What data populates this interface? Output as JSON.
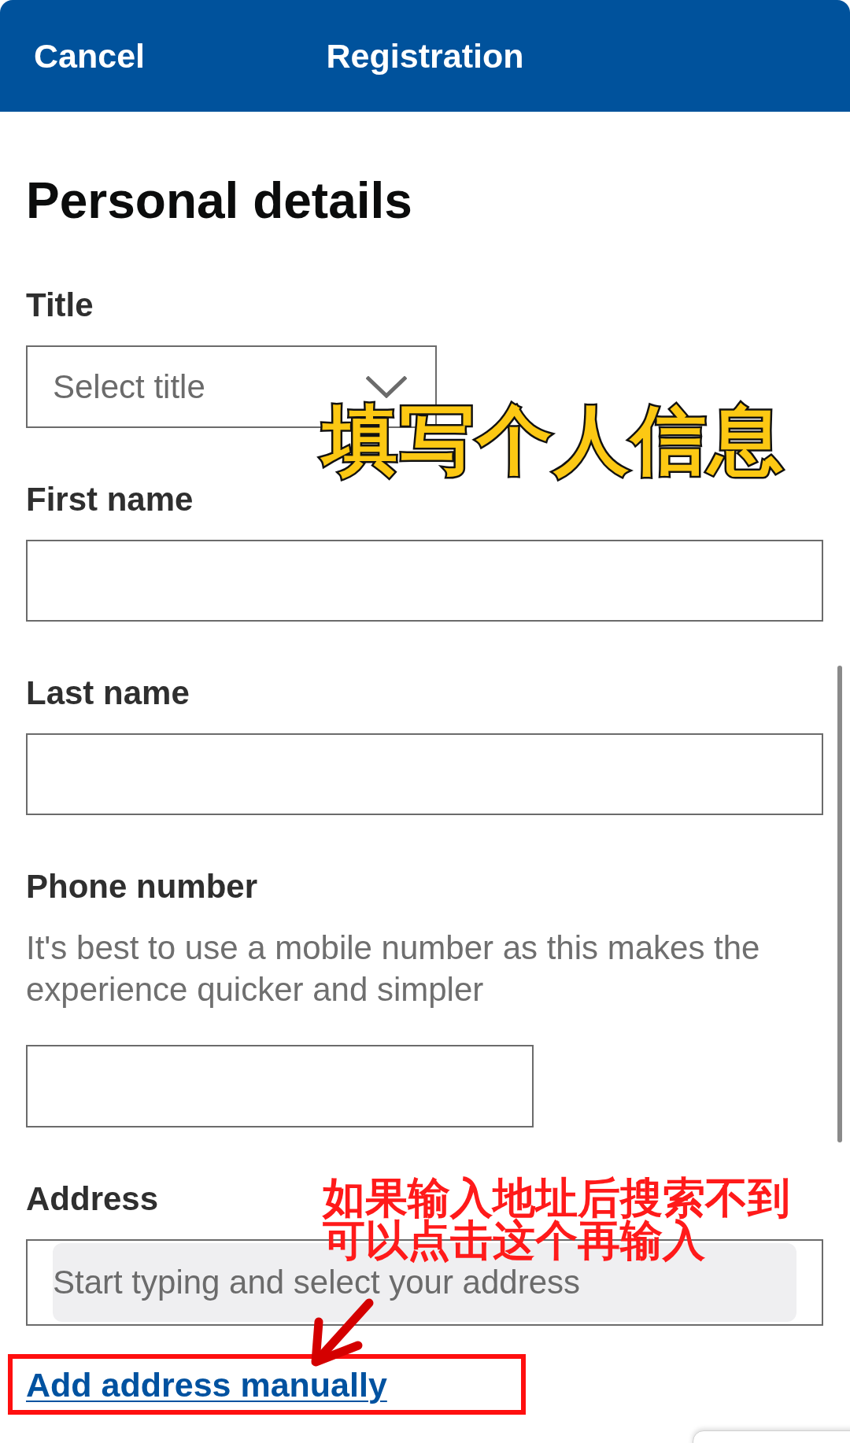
{
  "header": {
    "cancel": "Cancel",
    "title": "Registration"
  },
  "heading": "Personal details",
  "fields": [
    {
      "kind": "select",
      "label": "Title",
      "placeholder": "Select title"
    },
    {
      "kind": "text",
      "label": "First name"
    },
    {
      "kind": "text",
      "label": "Last name"
    },
    {
      "kind": "phone",
      "label": "Phone number",
      "hint": "It's best to use a mobile number as this makes the experience quicker and simpler"
    },
    {
      "kind": "address",
      "label": "Address",
      "placeholder": "Start typing and select your address"
    }
  ],
  "manual_address_link": "Add address manually",
  "overlay": {
    "caption": "填写个人信息",
    "note_lines": [
      "如果输入地址后搜索不到",
      "可以点击这个再输入"
    ]
  }
}
